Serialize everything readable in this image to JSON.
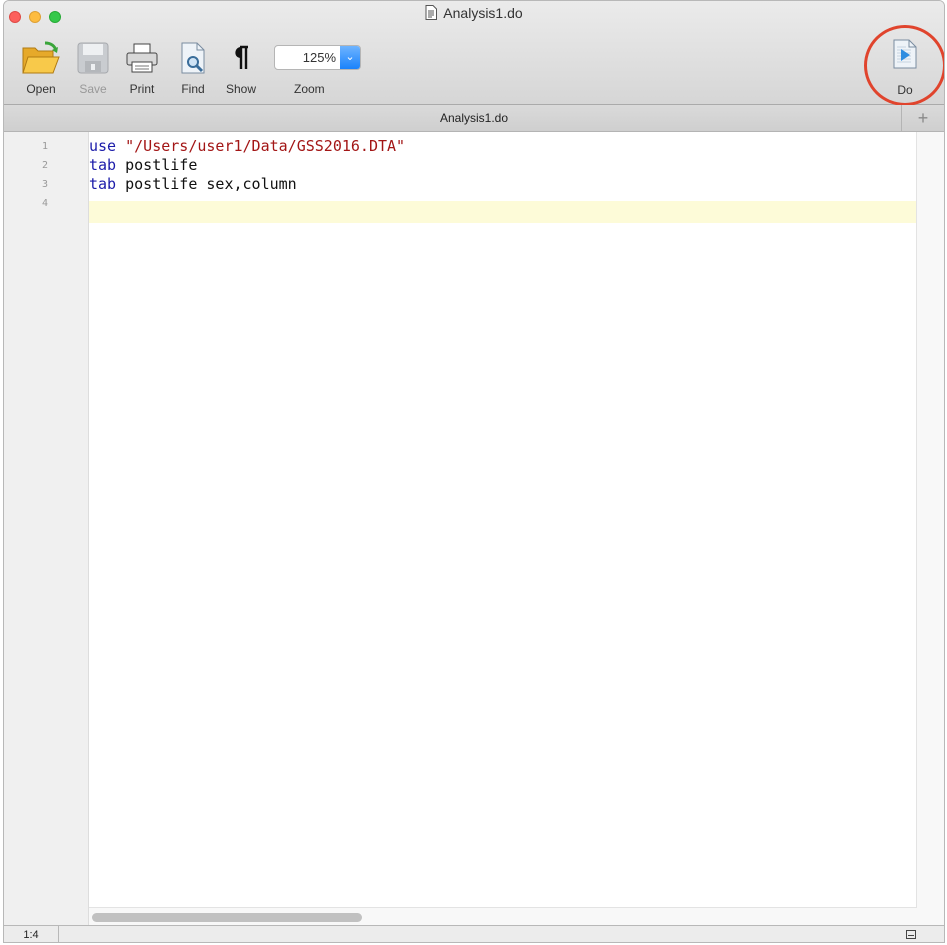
{
  "window": {
    "title": "Analysis1.do"
  },
  "toolbar": {
    "open_label": "Open",
    "save_label": "Save",
    "print_label": "Print",
    "find_label": "Find",
    "show_label": "Show",
    "zoom_label": "Zoom",
    "zoom_value": "125%",
    "do_label": "Do"
  },
  "tab": {
    "title": "Analysis1.do",
    "add_symbol": "+"
  },
  "editor": {
    "lines": [
      {
        "num": "1",
        "keyword": "use",
        "rest": " ",
        "string": "\"/Users/user1/Data/GSS2016.DTA\""
      },
      {
        "num": "2",
        "keyword": "tab",
        "rest": " postlife",
        "string": ""
      },
      {
        "num": "3",
        "keyword": "tab",
        "rest": " postlife sex,column",
        "string": ""
      },
      {
        "num": "4",
        "keyword": "",
        "rest": "",
        "string": ""
      }
    ]
  },
  "status": {
    "position": "1:4"
  },
  "colors": {
    "keyword": "#1c1caa",
    "string": "#a31616",
    "current_line": "#fdfbd8",
    "highlight_circle": "#e0442d"
  },
  "icons": [
    "open-folder-icon",
    "save-disk-icon",
    "print-icon",
    "find-icon",
    "pilcrow-icon",
    "chevron-down-icon",
    "do-file-icon",
    "document-icon"
  ]
}
